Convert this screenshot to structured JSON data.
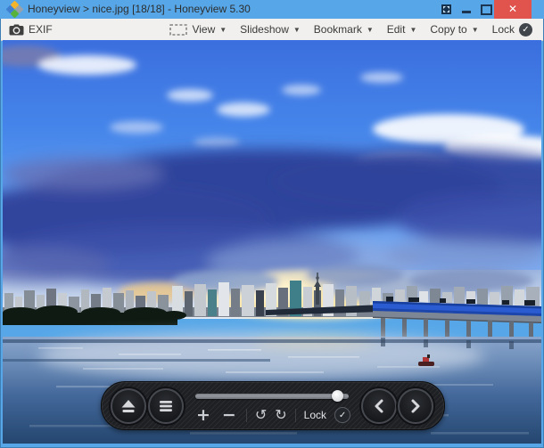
{
  "window": {
    "title": "Honeyview > nice.jpg [18/18] - Honeyview 5.30",
    "app_name": "Honeyview",
    "file_name": "nice.jpg",
    "position_in_list": "18/18",
    "version": "5.30"
  },
  "icons": {
    "caret_down": "▼",
    "check": "✓",
    "close": "✕",
    "rotate_left": "↺",
    "rotate_right": "↻"
  },
  "toolbar": {
    "exif_label": "EXIF",
    "menus": [
      {
        "label": "View"
      },
      {
        "label": "Slideshow"
      },
      {
        "label": "Bookmark"
      },
      {
        "label": "Edit"
      },
      {
        "label": "Copy to"
      }
    ],
    "lock_label": "Lock",
    "lock_checked": true
  },
  "viewer_controls": {
    "zoom_in_label": "+",
    "zoom_out_label": "−",
    "lock_label": "Lock",
    "lock_checked": true,
    "slider_percent": 93
  },
  "colors": {
    "titlebar_blue": "#57a7e8",
    "close_button_red": "#e1544d",
    "toolbar_bg": "#f1f0ee",
    "control_bar_dark": "#1e2024"
  }
}
